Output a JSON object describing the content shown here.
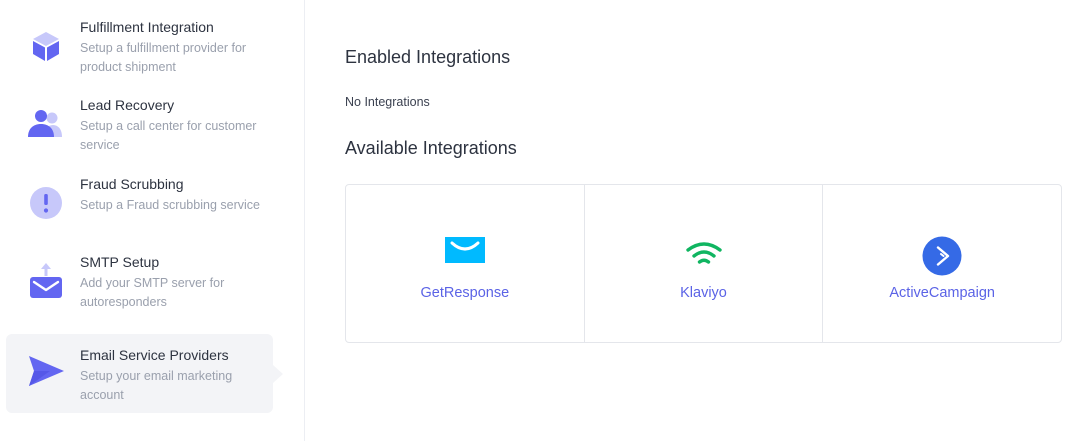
{
  "sidebar": {
    "items": [
      {
        "title": "Fulfillment Integration",
        "desc": "Setup a fulfillment provider for product shipment",
        "icon": "box-icon"
      },
      {
        "title": "Lead Recovery",
        "desc": "Setup a call center for customer service",
        "icon": "users-icon"
      },
      {
        "title": "Fraud Scrubbing",
        "desc": "Setup a Fraud scrubbing service",
        "icon": "exclamation-icon"
      },
      {
        "title": "SMTP Setup",
        "desc": "Add your SMTP server for autoresponders",
        "icon": "mail-upload-icon"
      },
      {
        "title": "Email Service Providers",
        "desc": "Setup your email marketing account",
        "icon": "send-icon",
        "active": true
      }
    ]
  },
  "main": {
    "enabled_heading": "Enabled Integrations",
    "enabled_empty": "No Integrations",
    "available_heading": "Available Integrations",
    "integrations": [
      {
        "label": "GetResponse",
        "icon": "getresponse-logo-icon"
      },
      {
        "label": "Klaviyo",
        "icon": "klaviyo-logo-icon"
      },
      {
        "label": "ActiveCampaign",
        "icon": "activecampaign-logo-icon"
      }
    ]
  },
  "colors": {
    "accent": "#5b63e6",
    "icon_primary": "#6366f1",
    "icon_light": "#c7c8fa",
    "getresponse": "#00baff",
    "klaviyo": "#10b561",
    "activecampaign": "#356ae6"
  }
}
